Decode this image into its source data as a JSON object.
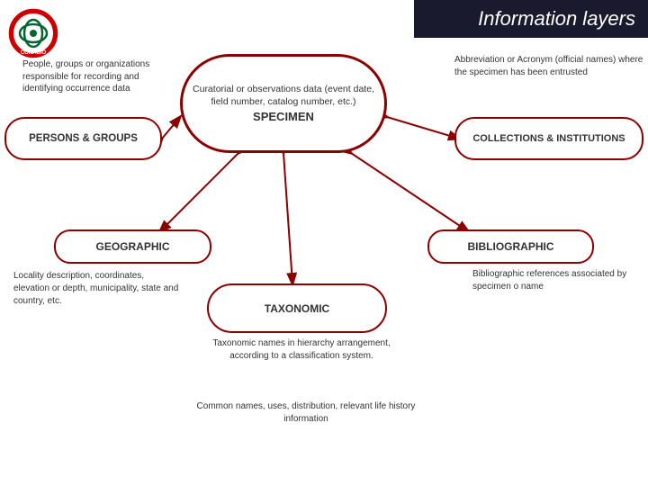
{
  "header": {
    "title": "Information layers",
    "bg_color": "#1a1a2e"
  },
  "logo": {
    "alt": "CONABIO logo"
  },
  "specimen": {
    "desc": "Curatorial or observations data (event date, field number, catalog number, etc.)",
    "label": "SPECIMEN"
  },
  "persons": {
    "left_desc": "People, groups or organizations responsible for recording and identifying occurrence data",
    "label": "PERSONS & GROUPS"
  },
  "collections": {
    "right_desc": "Abbreviation or Acronym (official names) where the specimen has been entrusted",
    "label": "COLLECTIONS & INSTITUTIONS"
  },
  "geographic": {
    "label": "GEOGRAPHIC",
    "desc": "Locality description, coordinates, elevation or depth, municipality, state and country, etc."
  },
  "bibliographic": {
    "label": "BIBLIOGRAPHIC",
    "desc": "Bibliographic references associated by specimen o name"
  },
  "taxonomic": {
    "label": "TAXONOMIC",
    "desc": "Taxonomic names in hierarchy arrangement, according to a classification system.",
    "common_desc": "Common names, uses, distribution, relevant life history information"
  }
}
